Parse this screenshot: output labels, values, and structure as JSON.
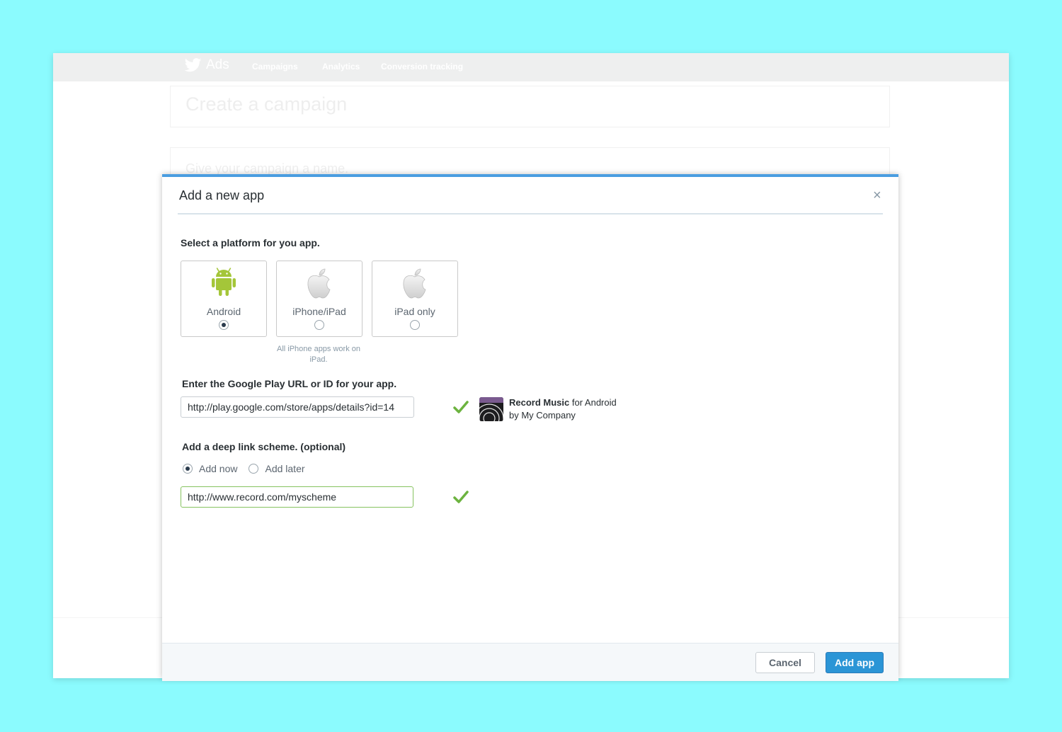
{
  "topbar": {
    "brand": "Ads",
    "nav": [
      "Campaigns",
      "Analytics",
      "Conversion tracking"
    ]
  },
  "background": {
    "page_title": "Create a campaign",
    "name_placeholder": "Give your campaign a name."
  },
  "modal": {
    "title": "Add a new app",
    "close": "×",
    "platform_label": "Select a platform for you app.",
    "platforms": [
      {
        "label": "Android",
        "icon": "android-icon",
        "selected": true
      },
      {
        "label": "iPhone/iPad",
        "icon": "apple-icon",
        "selected": false
      },
      {
        "label": "iPad only",
        "icon": "apple-icon",
        "selected": false
      }
    ],
    "platform_hint": "All iPhone apps work on iPad.",
    "url_label": "Enter the Google Play URL or ID for your app.",
    "url_value": "http://play.google.com/store/apps/details?id=14",
    "app": {
      "name": "Record Music",
      "suffix": " for Android",
      "publisher": "by My Company"
    },
    "deeplink_label": "Add a deep link scheme. (optional)",
    "deeplink_options": [
      "Add now",
      "Add later"
    ],
    "deeplink_selected": "Add now",
    "deeplink_value": "http://www.record.com/myscheme",
    "cancel": "Cancel",
    "submit": "Add app"
  },
  "colors": {
    "accent": "#2b95d6",
    "valid": "#6cb33f",
    "android": "#a4c639",
    "backdrop": "#8bfbfe"
  }
}
